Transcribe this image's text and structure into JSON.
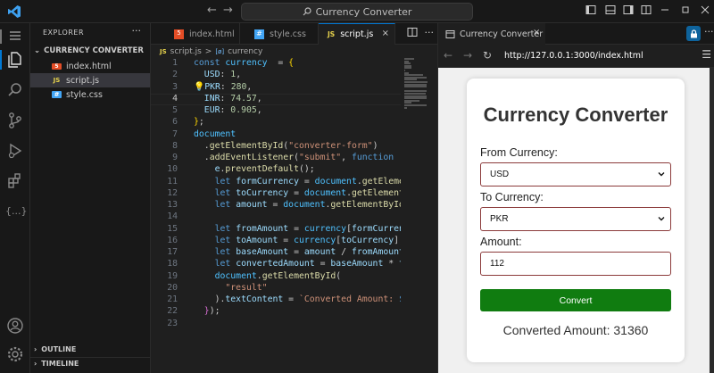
{
  "titlebar": {
    "search_text": "Currency Converter",
    "back_glyph": "←",
    "forward_glyph": "→"
  },
  "explorer": {
    "header": "EXPLORER",
    "dots": "···",
    "folder": "CURRENCY CONVERTER",
    "files": [
      {
        "name": "index.html",
        "icon_text": "5",
        "icon_color": "#e44d26"
      },
      {
        "name": "script.js",
        "icon_text": "JS",
        "icon_color": "#e8d44d"
      },
      {
        "name": "style.css",
        "icon_text": "#",
        "icon_color": "#42a5f5"
      }
    ],
    "outline": "OUTLINE",
    "timeline": "TIMELINE"
  },
  "editor": {
    "tabs": [
      {
        "label": "index.html",
        "icon_text": "5",
        "icon_color": "#e44d26"
      },
      {
        "label": "style.css",
        "icon_text": "#",
        "icon_color": "#42a5f5"
      },
      {
        "label": "script.js",
        "icon_text": "JS",
        "icon_color": "#e8d44d"
      }
    ],
    "close_glyph": "×",
    "breadcrumb": {
      "file": "script.js",
      "separator": ">",
      "symbol_icon": "[ø]",
      "symbol": "currency"
    },
    "current_line": 4,
    "lines": [
      [
        [
          "k",
          "const "
        ],
        [
          "v",
          "currency"
        ],
        [
          "",
          "  = "
        ],
        [
          "y",
          "{"
        ]
      ],
      [
        [
          "",
          "  "
        ],
        [
          "p",
          "USD"
        ],
        [
          "",
          ": "
        ],
        [
          "n",
          "1"
        ],
        [
          "",
          ","
        ]
      ],
      [
        [
          "y",
          "💡"
        ],
        [
          "p",
          "PKR"
        ],
        [
          "",
          ": "
        ],
        [
          "n",
          "280"
        ],
        [
          "",
          ","
        ]
      ],
      [
        [
          "",
          "  "
        ],
        [
          "p",
          "INR"
        ],
        [
          "",
          ": "
        ],
        [
          "n",
          "74.57"
        ],
        [
          "",
          ","
        ]
      ],
      [
        [
          "",
          "  "
        ],
        [
          "p",
          "EUR"
        ],
        [
          "",
          ": "
        ],
        [
          "n",
          "0.905"
        ],
        [
          "",
          ","
        ]
      ],
      [
        [
          "y",
          "}"
        ],
        [
          "",
          ";"
        ]
      ],
      [
        [
          "v",
          "document"
        ]
      ],
      [
        [
          "",
          "  ."
        ],
        [
          "f",
          "getElementById"
        ],
        [
          "",
          "("
        ],
        [
          "s",
          "\"converter-form\""
        ],
        [
          "",
          ")"
        ]
      ],
      [
        [
          "",
          "  ."
        ],
        [
          "f",
          "addEventListener"
        ],
        [
          "",
          "("
        ],
        [
          "s",
          "\"submit\""
        ],
        [
          "",
          ", "
        ],
        [
          "k",
          "function"
        ],
        [
          "",
          ""
        ],
        [
          "p",
          " (e)"
        ],
        [
          "",
          ""
        ]
      ],
      [
        [
          "",
          "    "
        ],
        [
          "p",
          "e"
        ],
        [
          "",
          "."
        ],
        [
          "f",
          "preventDefault"
        ],
        [
          "",
          "();"
        ]
      ],
      [
        [
          "",
          "    "
        ],
        [
          "k",
          "let "
        ],
        [
          "p",
          "formCurrency"
        ],
        [
          "",
          " = "
        ],
        [
          "v",
          "document"
        ],
        [
          "",
          "."
        ],
        [
          "f",
          "getElementB"
        ]
      ],
      [
        [
          "",
          "    "
        ],
        [
          "k",
          "let "
        ],
        [
          "p",
          "toCurrency"
        ],
        [
          "",
          " = "
        ],
        [
          "v",
          "document"
        ],
        [
          "",
          "."
        ],
        [
          "f",
          "getElementBy"
        ]
      ],
      [
        [
          "",
          "    "
        ],
        [
          "k",
          "let "
        ],
        [
          "p",
          "amount"
        ],
        [
          "",
          " = "
        ],
        [
          "v",
          "document"
        ],
        [
          "",
          "."
        ],
        [
          "f",
          "getElementById"
        ],
        [
          "",
          "(\""
        ]
      ],
      [
        [
          "",
          ""
        ]
      ],
      [
        [
          "",
          "    "
        ],
        [
          "k",
          "let "
        ],
        [
          "p",
          "fromAmount"
        ],
        [
          "",
          " = "
        ],
        [
          "v",
          "currency"
        ],
        [
          "",
          "["
        ],
        [
          "p",
          "formCurrency"
        ]
      ],
      [
        [
          "",
          "    "
        ],
        [
          "k",
          "let "
        ],
        [
          "p",
          "toAmount"
        ],
        [
          "",
          " = "
        ],
        [
          "v",
          "currency"
        ],
        [
          "",
          "["
        ],
        [
          "p",
          "toCurrency"
        ],
        [
          "",
          "];"
        ]
      ],
      [
        [
          "",
          "    "
        ],
        [
          "k",
          "let "
        ],
        [
          "p",
          "baseAmount"
        ],
        [
          "",
          " = "
        ],
        [
          "p",
          "amount"
        ],
        [
          "",
          " / "
        ],
        [
          "p",
          "fromAmount"
        ],
        [
          "",
          ";"
        ]
      ],
      [
        [
          "",
          "    "
        ],
        [
          "k",
          "let "
        ],
        [
          "p",
          "convertedAmount"
        ],
        [
          "",
          " = "
        ],
        [
          "p",
          "baseAmount"
        ],
        [
          "",
          " * "
        ],
        [
          "p",
          "toA"
        ]
      ],
      [
        [
          "",
          "    "
        ],
        [
          "v",
          "document"
        ],
        [
          "",
          "."
        ],
        [
          "f",
          "getElementById"
        ],
        [
          "",
          "("
        ]
      ],
      [
        [
          "",
          "      "
        ],
        [
          "s",
          "\"result\""
        ]
      ],
      [
        [
          "",
          "    )."
        ],
        [
          "p",
          "textContent"
        ],
        [
          "",
          " = "
        ],
        [
          "s",
          "`Converted Amount: "
        ],
        [
          "k",
          "${"
        ],
        [
          "p",
          "M"
        ]
      ],
      [
        [
          "",
          "  "
        ],
        [
          "m",
          "}"
        ],
        [
          "",
          ");"
        ]
      ],
      [
        [
          "",
          ""
        ]
      ]
    ]
  },
  "browser": {
    "tab_title": "Currency Converter",
    "url": "http://127.0.0.1:3000/index.html",
    "nav": {
      "back": "←",
      "forward": "→",
      "reload": "↻"
    },
    "menu_glyph": "☰",
    "lock_glyph": "🔒",
    "more_glyph": "···"
  },
  "converter": {
    "title": "Currency Converter",
    "from_label": "From Currency:",
    "from_value": "USD",
    "to_label": "To Currency:",
    "to_value": "PKR",
    "amount_label": "Amount:",
    "amount_value": "112",
    "convert_label": "Convert",
    "result": "Converted Amount: 31360",
    "button_color": "#107c10",
    "border_color": "#8b3a3a"
  }
}
